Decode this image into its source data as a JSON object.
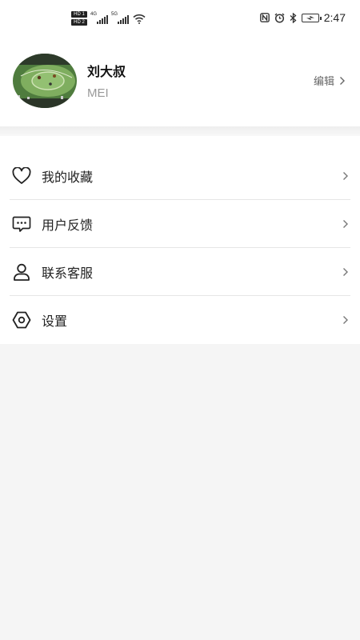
{
  "status_bar": {
    "hd1": "HD 1",
    "hd2": "HD 2",
    "sig1_tag": "4G",
    "sig2_tag": "5G",
    "time": "2:47",
    "icons": [
      "nfc-icon",
      "alarm-icon",
      "bluetooth-icon",
      "battery-icon"
    ]
  },
  "profile": {
    "name": "刘大叔",
    "subname": "MEI",
    "edit_label": "编辑"
  },
  "menu": {
    "items": [
      {
        "label": "我的收藏",
        "icon": "heart-icon"
      },
      {
        "label": "用户反馈",
        "icon": "feedback-icon"
      },
      {
        "label": "联系客服",
        "icon": "user-icon"
      },
      {
        "label": "设置",
        "icon": "settings-icon"
      }
    ]
  },
  "colors": {
    "background": "#f5f5f5",
    "card": "#ffffff",
    "text": "#222222",
    "secondary_text": "#999999",
    "divider": "#e6e6e6"
  }
}
